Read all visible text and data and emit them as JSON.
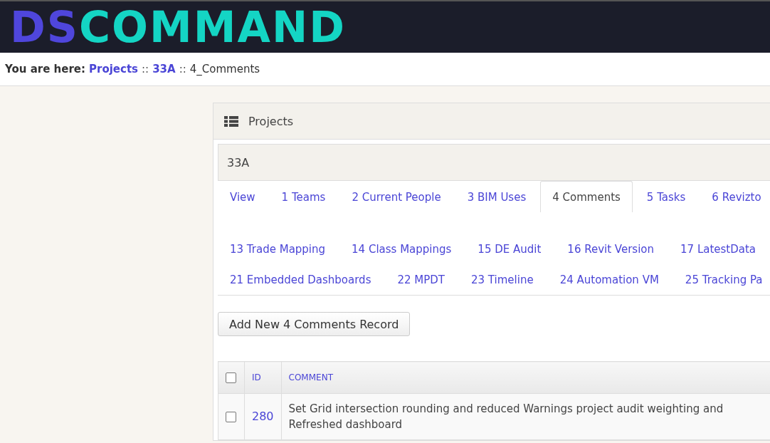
{
  "logo": {
    "part_1": "DS",
    "part_2": "COMMAND"
  },
  "breadcrumb": {
    "prefix": "You are here:",
    "items": [
      {
        "label": "Projects",
        "link": true
      },
      {
        "label": "33A",
        "link": true
      },
      {
        "label": "4_Comments",
        "link": false
      }
    ],
    "separator": "::"
  },
  "panel": {
    "title": "Projects"
  },
  "project": {
    "name": "33A"
  },
  "tab_rows": [
    [
      {
        "label": "View",
        "selected": false
      },
      {
        "label": "1 Teams",
        "selected": false
      },
      {
        "label": "2 Current People",
        "selected": false
      },
      {
        "label": "3 BIM Uses",
        "selected": false
      },
      {
        "label": "4 Comments",
        "selected": true
      },
      {
        "label": "5 Tasks",
        "selected": false
      },
      {
        "label": "6 Revizto",
        "selected": false
      }
    ],
    [
      {
        "label": "13 Trade Mapping",
        "selected": false
      },
      {
        "label": "14 Class Mappings",
        "selected": false
      },
      {
        "label": "15 DE Audit",
        "selected": false
      },
      {
        "label": "16 Revit Version",
        "selected": false
      },
      {
        "label": "17 LatestData",
        "selected": false
      }
    ],
    [
      {
        "label": "21 Embedded Dashboards",
        "selected": false
      },
      {
        "label": "22 MPDT",
        "selected": false
      },
      {
        "label": "23 Timeline",
        "selected": false
      },
      {
        "label": "24 Automation VM",
        "selected": false
      },
      {
        "label": "25 Tracking Pa",
        "selected": false
      }
    ]
  ],
  "add_button": "Add New 4 Comments Record",
  "table": {
    "select_all_checked": false,
    "columns": [
      "ID",
      "COMMENT"
    ],
    "rows": [
      {
        "checked": false,
        "id": "280",
        "comment": "Set Grid intersection rounding and reduced Warnings project audit weighting and Refreshed dashboard"
      }
    ]
  }
}
